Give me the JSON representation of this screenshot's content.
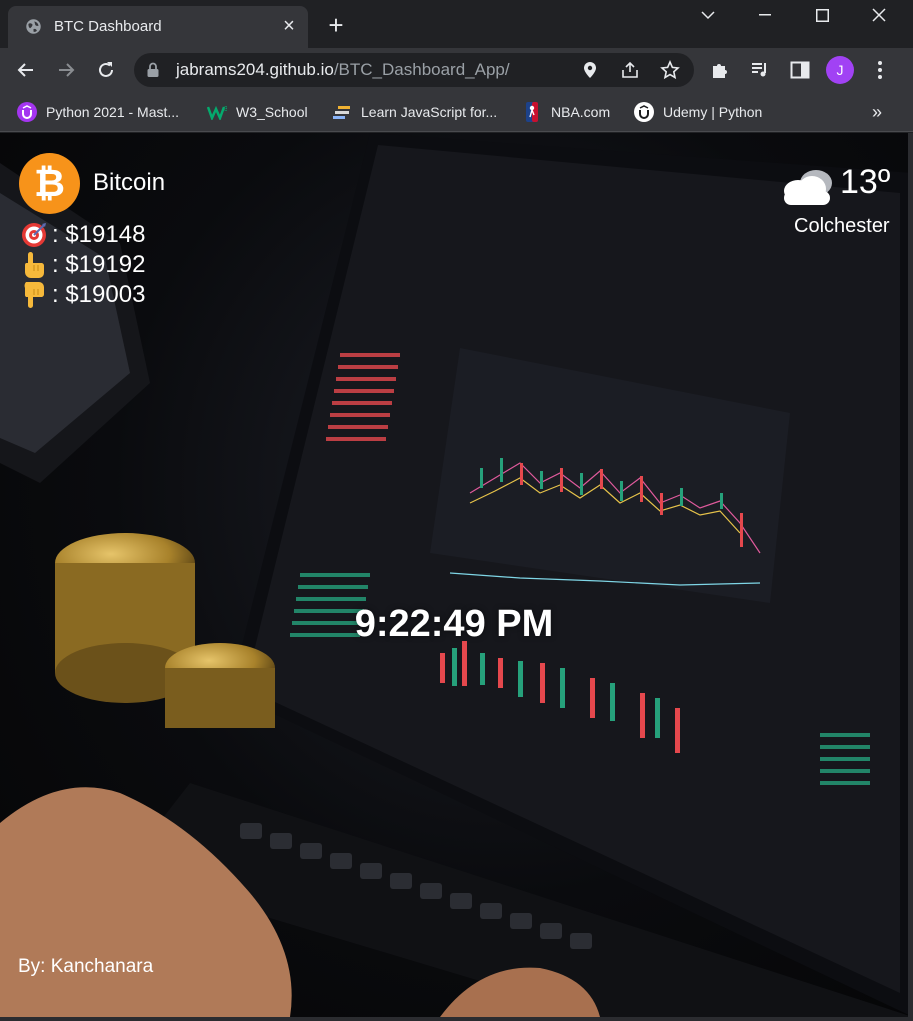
{
  "browser": {
    "tab": {
      "title": "BTC Dashboard"
    },
    "url": {
      "domain": "jabrams204.github.io",
      "path": "/BTC_Dashboard_App/"
    },
    "profile_initial": "J",
    "bookmarks": [
      {
        "label": "Python 2021 - Mast...",
        "icon": "udemy-icon"
      },
      {
        "label": "W3_School",
        "icon": "w3schools-icon"
      },
      {
        "label": "Learn JavaScript for...",
        "icon": "bookmark-icon"
      },
      {
        "label": "NBA.com",
        "icon": "nba-icon"
      },
      {
        "label": "Udemy | Python",
        "icon": "udemy-icon"
      }
    ],
    "bookmarks_overflow": "»"
  },
  "dashboard": {
    "coin": {
      "name": "Bitcoin",
      "symbol": "₿",
      "color": "#f7931a"
    },
    "prices": [
      {
        "icon": "target-icon",
        "label": ": $19148"
      },
      {
        "icon": "pointing-up-icon",
        "label": ": $19192"
      },
      {
        "icon": "pointing-down-icon",
        "label": ": $19003"
      }
    ],
    "weather": {
      "temp": "13º",
      "city": "Colchester",
      "icon": "cloud-icon"
    },
    "time": "9:22:49 PM",
    "author": "By: Kanchanara"
  },
  "colors": {
    "chrome_dark": "#202124",
    "chrome_toolbar": "#35363a",
    "profile": "#a142f4"
  }
}
